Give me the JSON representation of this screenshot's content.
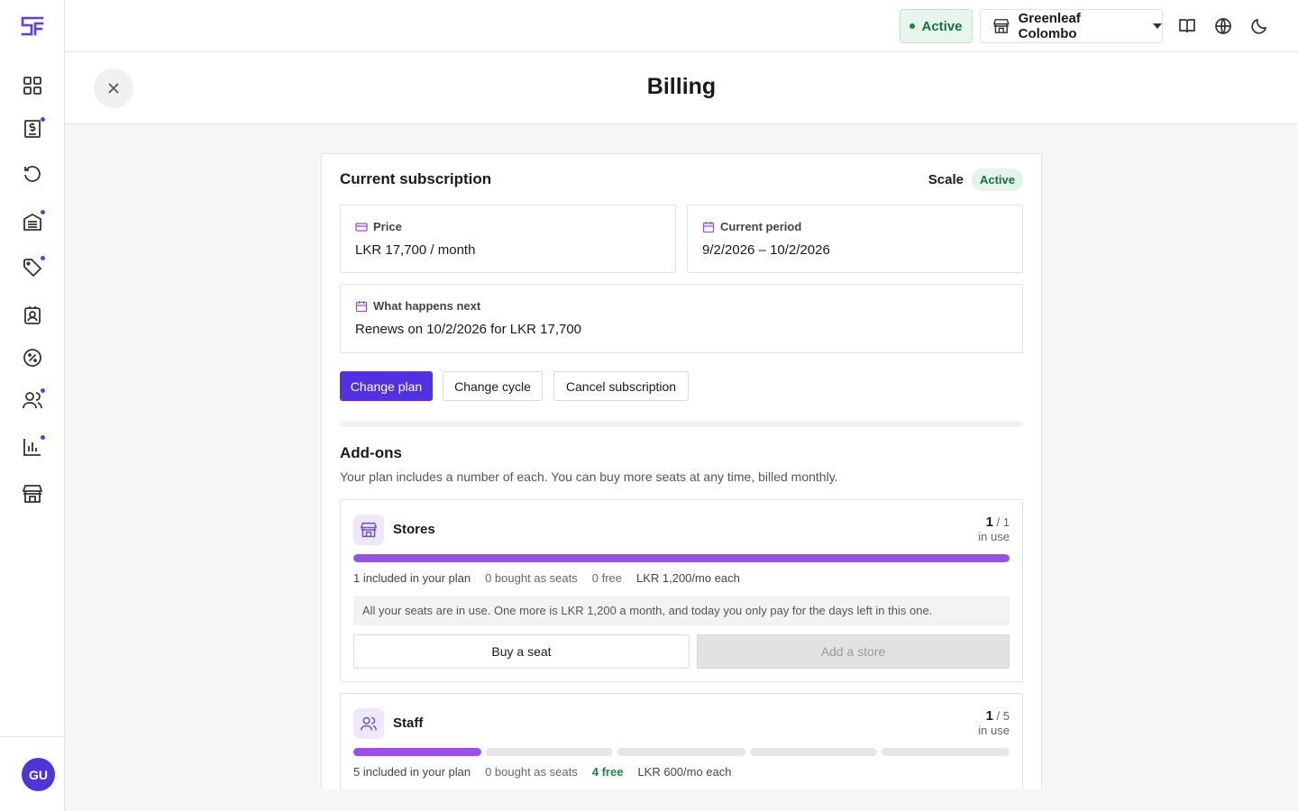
{
  "app": {
    "logo": "SF",
    "avatar_initials": "GU"
  },
  "sidebar": {
    "items": [
      {
        "name": "dashboard",
        "icon": "grid-icon",
        "badge": false
      },
      {
        "name": "billing",
        "icon": "invoice-icon",
        "badge": true
      },
      {
        "name": "history",
        "icon": "history-icon",
        "badge": false
      },
      {
        "name": "inventory",
        "icon": "inventory-icon",
        "badge": true
      },
      {
        "name": "tags",
        "icon": "tag-icon",
        "badge": true
      },
      {
        "name": "contacts",
        "icon": "contact-icon",
        "badge": false
      },
      {
        "name": "discounts",
        "icon": "discount-icon",
        "badge": false
      },
      {
        "name": "users",
        "icon": "users-icon",
        "badge": true
      },
      {
        "name": "reports",
        "icon": "chart-icon",
        "badge": true
      },
      {
        "name": "stores",
        "icon": "store-icon",
        "badge": false
      }
    ]
  },
  "topbar": {
    "status": "Active",
    "store": "Greenleaf Colombo",
    "status_color": "#178a45"
  },
  "page": {
    "title": "Billing"
  },
  "subscription": {
    "title": "Current subscription",
    "plan": "Scale",
    "plan_status": "Active",
    "price_label": "Price",
    "price_value": "LKR 17,700 / month",
    "period_label": "Current period",
    "period_value": "9/2/2026 – 10/2/2026",
    "next_label": "What happens next",
    "next_value": "Renews on 10/2/2026 for LKR 17,700",
    "buttons": {
      "change_plan": "Change plan",
      "change_cycle": "Change cycle",
      "cancel": "Cancel subscription"
    },
    "accent_color": "#5231e0"
  },
  "addons": {
    "title": "Add-ons",
    "description": "Your plan includes a number of each. You can buy more seats at any time, billed monthly.",
    "items": [
      {
        "name": "Stores",
        "used": "1",
        "total": "/ 1",
        "in_use_label": "in use",
        "usage_fraction": 1.0,
        "included": "1 included in your plan",
        "bought": "0 bought as seats",
        "free": "0 free",
        "price": "LKR 1,200/mo each",
        "note": "All your seats are in use. One more is LKR 1,200 a month, and today you only pay for the days left in this one.",
        "buy_label": "Buy a seat",
        "add_label": "Add a store"
      },
      {
        "name": "Staff",
        "used": "1",
        "total": "/ 5",
        "in_use_label": "in use",
        "seats_used": 1,
        "seats_total": 5,
        "included": "5 included in your plan",
        "bought": "0 bought as seats",
        "free": "4 free",
        "price": "LKR 600/mo each"
      }
    ]
  }
}
